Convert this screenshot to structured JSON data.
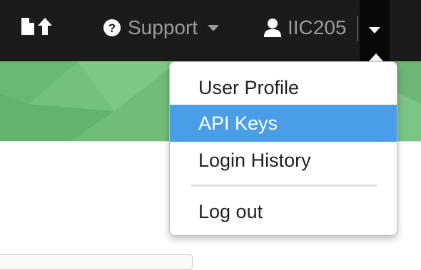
{
  "navbar": {
    "upload_icon": "file-upload-icon",
    "support": {
      "label": "Support",
      "icon": "question-circle-icon",
      "caret": "caret-down-icon"
    },
    "user": {
      "label": "IIC205",
      "icon": "user-icon"
    },
    "toggle_icon": "caret-down-icon"
  },
  "dropdown": {
    "items": [
      {
        "label": "User Profile",
        "active": false
      },
      {
        "label": "API Keys",
        "active": true
      },
      {
        "label": "Login History",
        "active": false
      },
      {
        "label": "Log out",
        "active": false
      }
    ]
  },
  "colors": {
    "navbar_bg": "#1b1b1b",
    "nav_text": "#9b9b9b",
    "active_item_bg": "#4a9ee8",
    "hero_green": "#74c07c"
  }
}
